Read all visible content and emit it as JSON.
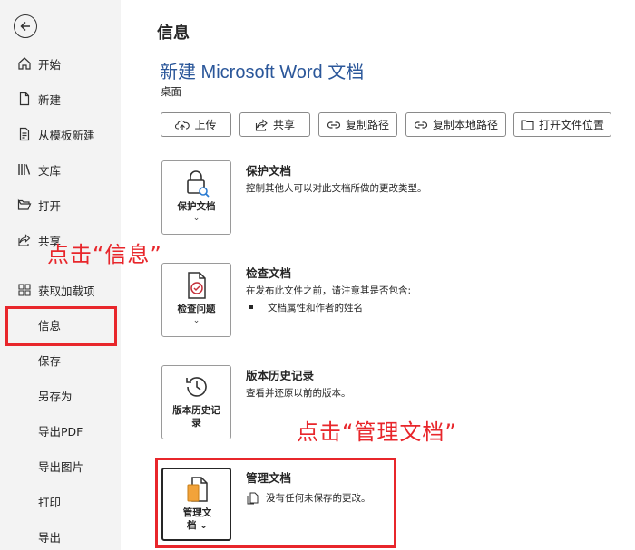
{
  "sidebar": {
    "items": [
      {
        "label": "开始",
        "icon": "home-icon"
      },
      {
        "label": "新建",
        "icon": "new-document-icon"
      },
      {
        "label": "从模板新建",
        "icon": "template-icon"
      },
      {
        "label": "文库",
        "icon": "library-icon"
      },
      {
        "label": "打开",
        "icon": "folder-open-icon"
      },
      {
        "label": "共享",
        "icon": "share-icon"
      },
      {
        "label": "获取加载项",
        "icon": "add-ins-icon"
      },
      {
        "label": "信息",
        "selected": true
      },
      {
        "label": "保存"
      },
      {
        "label": "另存为"
      },
      {
        "label": "导出PDF"
      },
      {
        "label": "导出图片"
      },
      {
        "label": "打印"
      },
      {
        "label": "导出"
      }
    ]
  },
  "main": {
    "page_title": "信息",
    "document_title": "新建 Microsoft Word 文档",
    "document_location": "桌面",
    "actions": [
      {
        "label": "上传",
        "icon": "upload-icon"
      },
      {
        "label": "共享",
        "icon": "share-icon"
      },
      {
        "label": "复制路径",
        "icon": "link-icon"
      },
      {
        "label": "复制本地路径",
        "icon": "link-icon"
      },
      {
        "label": "打开文件位置",
        "icon": "folder-icon"
      }
    ],
    "sections": {
      "protect": {
        "tile_label": "保护文档",
        "title": "保护文档",
        "description": "控制其他人可以对此文档所做的更改类型。"
      },
      "inspect": {
        "tile_label": "检查问题",
        "title": "检查文档",
        "description": "在发布此文件之前，请注意其是否包含:",
        "bullets": [
          "文档属性和作者的姓名"
        ]
      },
      "history": {
        "tile_label_line1": "版本历史记",
        "tile_label_line2": "录",
        "title": "版本历史记录",
        "description": "查看并还原以前的版本。"
      },
      "manage": {
        "tile_label_line1": "管理文",
        "tile_label_line2": "档",
        "title": "管理文档",
        "description": "没有任何未保存的更改。"
      }
    }
  },
  "annotations": {
    "click_info": "点击“信息”",
    "click_manage": "点击“管理文档”"
  },
  "colors": {
    "accent_title": "#2b579a",
    "annotation_red": "#e8262b",
    "sidebar_bg": "#f3f3f3"
  }
}
